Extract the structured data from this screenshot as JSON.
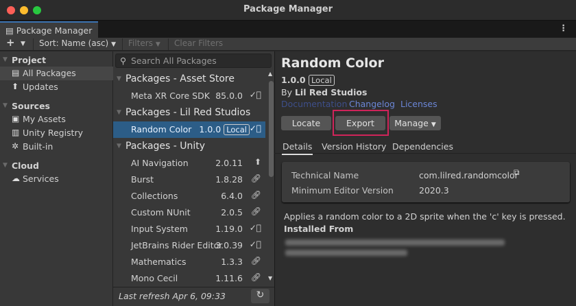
{
  "window": {
    "title": "Package Manager",
    "tab": "Package Manager"
  },
  "toolbar": {
    "add": "+",
    "sort": "Sort: Name (asc)",
    "filters": "Filters",
    "clear_filters": "Clear Filters"
  },
  "sidebar": {
    "sections": [
      {
        "label": "Project",
        "items": [
          {
            "label": "All Packages",
            "icon": "packages-icon"
          },
          {
            "label": "Updates",
            "icon": "update-arrow-icon"
          }
        ]
      },
      {
        "label": "Sources",
        "items": [
          {
            "label": "My Assets",
            "icon": "my-assets-icon"
          },
          {
            "label": "Unity Registry",
            "icon": "registry-icon"
          },
          {
            "label": "Built-in",
            "icon": "builtin-icon"
          }
        ]
      },
      {
        "label": "Cloud",
        "items": [
          {
            "label": "Services",
            "icon": "cloud-icon"
          }
        ]
      }
    ]
  },
  "list": {
    "search_placeholder": "Search All Packages",
    "groups": [
      {
        "label": "Packages - Asset Store",
        "items": [
          {
            "name": "Meta XR Core SDK",
            "version": "85.0.0",
            "status": "installed"
          }
        ]
      },
      {
        "label": "Packages - Lil Red Studios",
        "items": [
          {
            "name": "Random Color",
            "version": "1.0.0",
            "badge": "Local",
            "status": "installed",
            "selected": true
          }
        ]
      },
      {
        "label": "Packages - Unity",
        "items": [
          {
            "name": "AI Navigation",
            "version": "2.0.11",
            "status": "update"
          },
          {
            "name": "Burst",
            "version": "1.8.28",
            "status": "linked"
          },
          {
            "name": "Collections",
            "version": "6.4.0",
            "status": "linked"
          },
          {
            "name": "Custom NUnit",
            "version": "2.0.5",
            "status": "linked"
          },
          {
            "name": "Input System",
            "version": "1.19.0",
            "status": "installed"
          },
          {
            "name": "JetBrains Rider Editor",
            "version": "3.0.39",
            "status": "installed"
          },
          {
            "name": "Mathematics",
            "version": "1.3.3",
            "status": "linked"
          },
          {
            "name": "Mono Cecil",
            "version": "1.11.6",
            "status": "linked"
          }
        ]
      }
    ],
    "last_refresh": "Last refresh Apr 6, 09:33"
  },
  "details": {
    "name": "Random Color",
    "version": "1.0.0",
    "badge": "Local",
    "by": "By",
    "author": "Lil Red Studios",
    "links": [
      "Documentation",
      "Changelog",
      "Licenses"
    ],
    "buttons": {
      "locate": "Locate",
      "export": "Export",
      "manage": "Manage"
    },
    "tabs": [
      "Details",
      "Version History",
      "Dependencies"
    ],
    "info": [
      {
        "label": "Technical Name",
        "value": "com.lilred.randomcolor"
      },
      {
        "label": "Minimum Editor Version",
        "value": "2020.3"
      }
    ],
    "description": "Applies a random color to a 2D sprite when the 'c' key is pressed.",
    "installed_from_label": "Installed From",
    "highlight_color": "#d0245a"
  }
}
